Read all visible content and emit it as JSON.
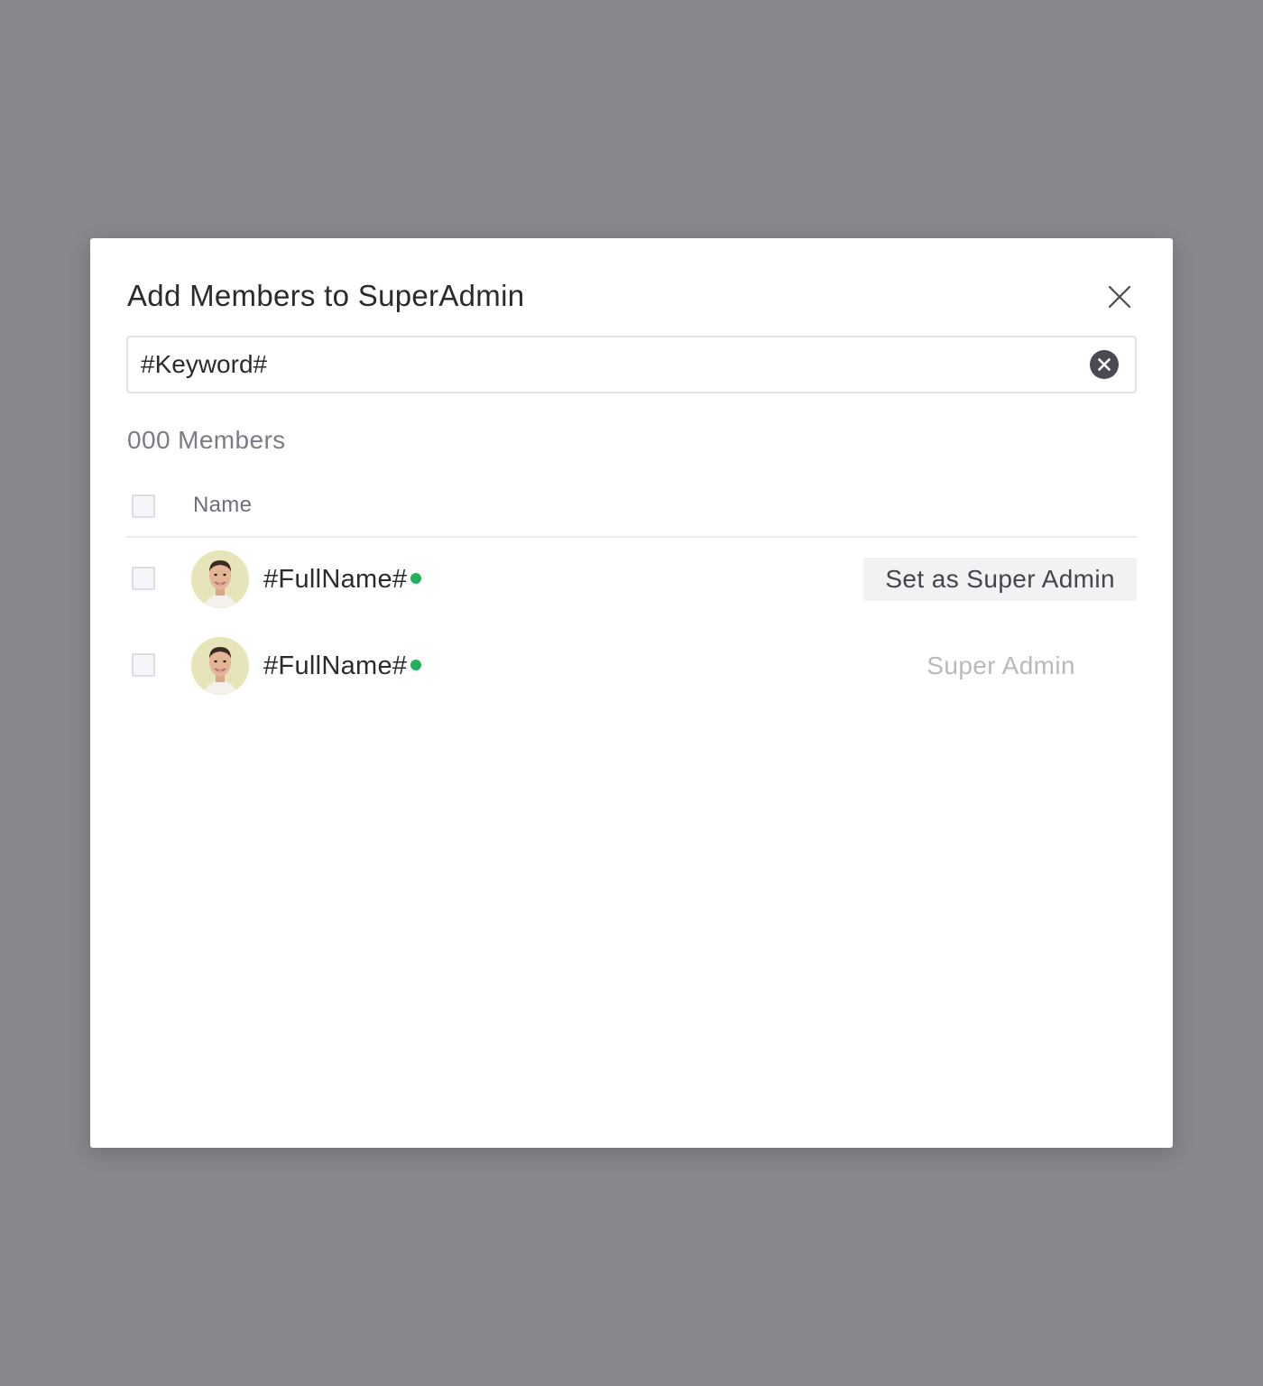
{
  "modal": {
    "title": "Add Members to SuperAdmin",
    "close_icon": "close-icon"
  },
  "search": {
    "value": "#Keyword#",
    "clear_icon": "clear-circle-icon"
  },
  "members_count": "000 Members",
  "table": {
    "header_name": "Name"
  },
  "members": [
    {
      "name": "#FullName#",
      "status": "online",
      "status_color": "#1fb35a",
      "action_label": "Set as Super Admin",
      "role_label": ""
    },
    {
      "name": "#FullName#",
      "status": "online",
      "status_color": "#1fb35a",
      "action_label": "",
      "role_label": "Super Admin"
    }
  ],
  "colors": {
    "backdrop": "#88878c",
    "online": "#1fb35a"
  }
}
